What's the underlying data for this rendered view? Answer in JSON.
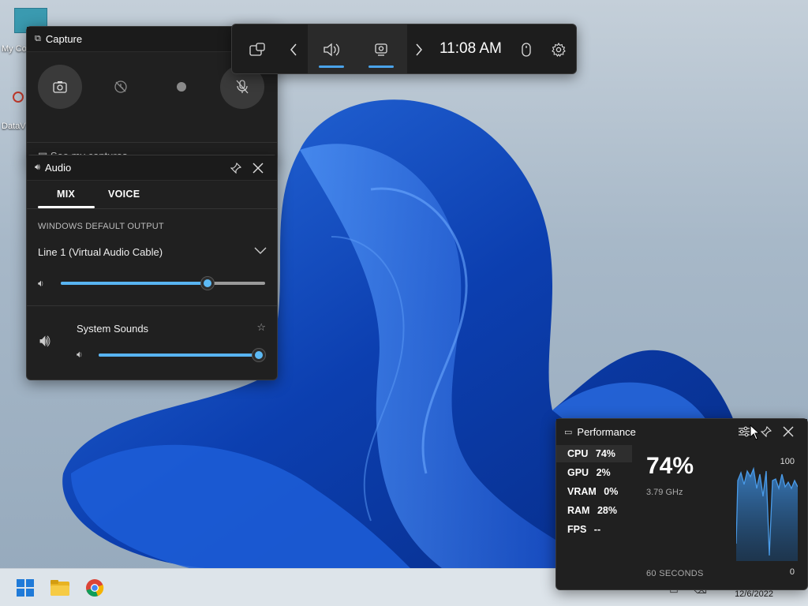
{
  "desktop": {
    "icons": [
      {
        "label": "My Co",
        "icon": "computer-icon"
      },
      {
        "label": "DataV",
        "icon": "app-shortcut-icon"
      }
    ]
  },
  "capture": {
    "title": "Capture",
    "see_captures": "See my captures",
    "buttons": [
      "screenshot-icon",
      "record-last-icon",
      "record-icon",
      "mic-off-icon"
    ]
  },
  "gamebar": {
    "time": "11:08 AM",
    "icons": [
      "widget-menu-icon",
      "chevron-left-icon",
      "audio-icon",
      "capture-icon",
      "chevron-right-icon",
      "mouse-icon",
      "gear-icon"
    ]
  },
  "audio": {
    "title": "Audio",
    "tabs": {
      "mix": "MIX",
      "voice": "VOICE"
    },
    "output_label": "WINDOWS DEFAULT OUTPUT",
    "device": "Line 1 (Virtual Audio Cable)",
    "device_volume": 0.72,
    "app": {
      "name": "System Sounds",
      "volume": 1.0
    }
  },
  "performance": {
    "title": "Performance",
    "metrics": [
      {
        "name": "CPU",
        "value": "74%"
      },
      {
        "name": "GPU",
        "value": "2%"
      },
      {
        "name": "VRAM",
        "value": "0%"
      },
      {
        "name": "RAM",
        "value": "28%"
      },
      {
        "name": "FPS",
        "value": "--"
      }
    ],
    "big_value": "74%",
    "frequency": "3.79 GHz",
    "duration": "60 SECONDS",
    "axis_max": "100",
    "axis_min": "0"
  },
  "taskbar": {
    "date": "12/6/2022",
    "apps": [
      "start-icon",
      "file-explorer-icon",
      "chrome-icon"
    ]
  },
  "colors": {
    "accent": "#4aa3ea",
    "slider": "#58b4f2",
    "widget_bg": "#202020"
  }
}
